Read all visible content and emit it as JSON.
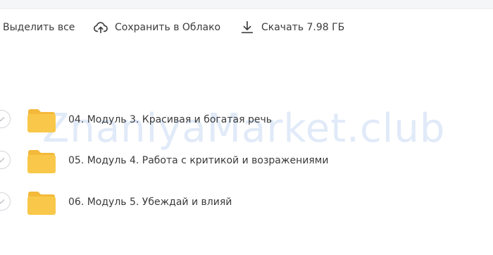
{
  "toolbar": {
    "select_all": "Выделить все",
    "save_to_cloud": "Сохранить в Облако",
    "download": "Скачать 7.98 ГБ"
  },
  "files": [
    {
      "name": "04. Модуль 3. Красивая и богатая речь",
      "icon": "folder-icon"
    },
    {
      "name": "05. Модуль 4. Работа с критикой и возражениями",
      "icon": "folder-icon"
    },
    {
      "name": "06. Модуль 5. Убеждай и влияй",
      "icon": "folder-icon"
    }
  ],
  "watermark": "ZnaniyaMarket.club",
  "colors": {
    "folder": "#f9c84a",
    "folder_tab": "#f3b93a",
    "text": "#3a3a3a",
    "check_border": "#d3d6db",
    "topbar": "#f5f6f8"
  }
}
